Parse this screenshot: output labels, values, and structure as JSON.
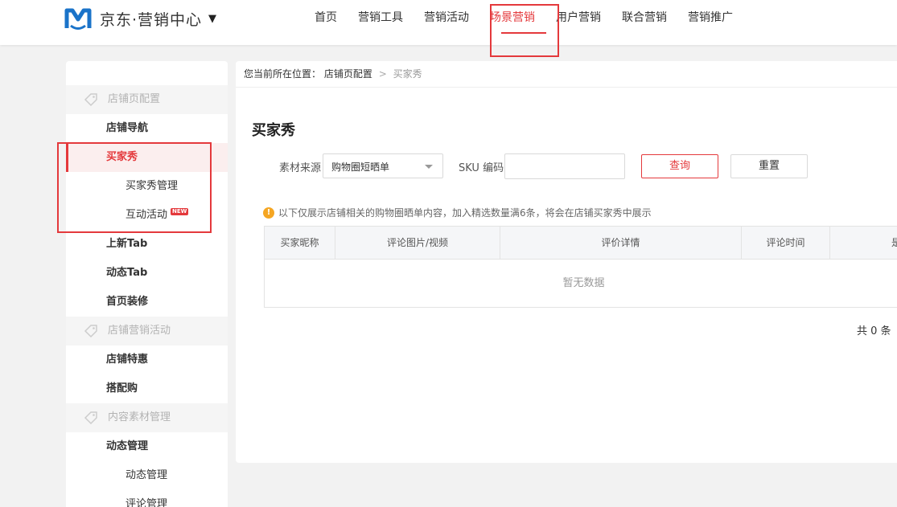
{
  "brand": {
    "name": "京东·营销中心",
    "caret": "▼",
    "logo_icon": "jd-logo-icon"
  },
  "nav": {
    "items": [
      {
        "label": "首页",
        "active": false
      },
      {
        "label": "营销工具",
        "active": false
      },
      {
        "label": "营销活动",
        "active": false
      },
      {
        "label": "场景营销",
        "active": true
      },
      {
        "label": "用户营销",
        "active": false
      },
      {
        "label": "联合营销",
        "active": false
      },
      {
        "label": "营销推广",
        "active": false
      }
    ]
  },
  "sidebar": {
    "groups": [
      {
        "label": "店铺页配置",
        "icon": "tag-icon"
      },
      {
        "label": "店铺营销活动",
        "icon": "tag-icon"
      },
      {
        "label": "内容素材管理",
        "icon": "tag-icon"
      }
    ],
    "items": [
      {
        "label": "店铺导航"
      },
      {
        "label": "买家秀",
        "active": true
      },
      {
        "label": "买家秀管理"
      },
      {
        "label": "互动活动",
        "badge": "NEW"
      },
      {
        "label": "上新Tab"
      },
      {
        "label": "动态Tab"
      },
      {
        "label": "首页装修"
      },
      {
        "label": "店铺特惠"
      },
      {
        "label": "搭配购"
      },
      {
        "label": "动态管理"
      },
      {
        "label": "动态管理"
      },
      {
        "label": "评论管理"
      }
    ]
  },
  "breadcrumb": {
    "prefix": "您当前所在位置：",
    "parent": "店铺页配置",
    "separator": ">",
    "current": "买家秀"
  },
  "page": {
    "title": "买家秀",
    "filters": {
      "source_label": "素材来源",
      "source_value": "购物圈短晒单",
      "sku_label": "SKU 编码",
      "sku_value": "",
      "query_label": "查询",
      "reset_label": "重置"
    },
    "notice": {
      "icon": "!",
      "text": "以下仅展示店铺相关的购物圈晒单内容，加入精选数量满6条，将会在店铺买家秀中展示"
    },
    "table": {
      "columns": [
        "买家昵称",
        "评论图片/视频",
        "评价详情",
        "评论时间",
        "是"
      ],
      "empty_text": "暂无数据"
    },
    "total": "共 0 条"
  },
  "colors": {
    "accent": "#e4393c",
    "warning": "#f5a623",
    "brand_blue": "#1a73c9"
  }
}
